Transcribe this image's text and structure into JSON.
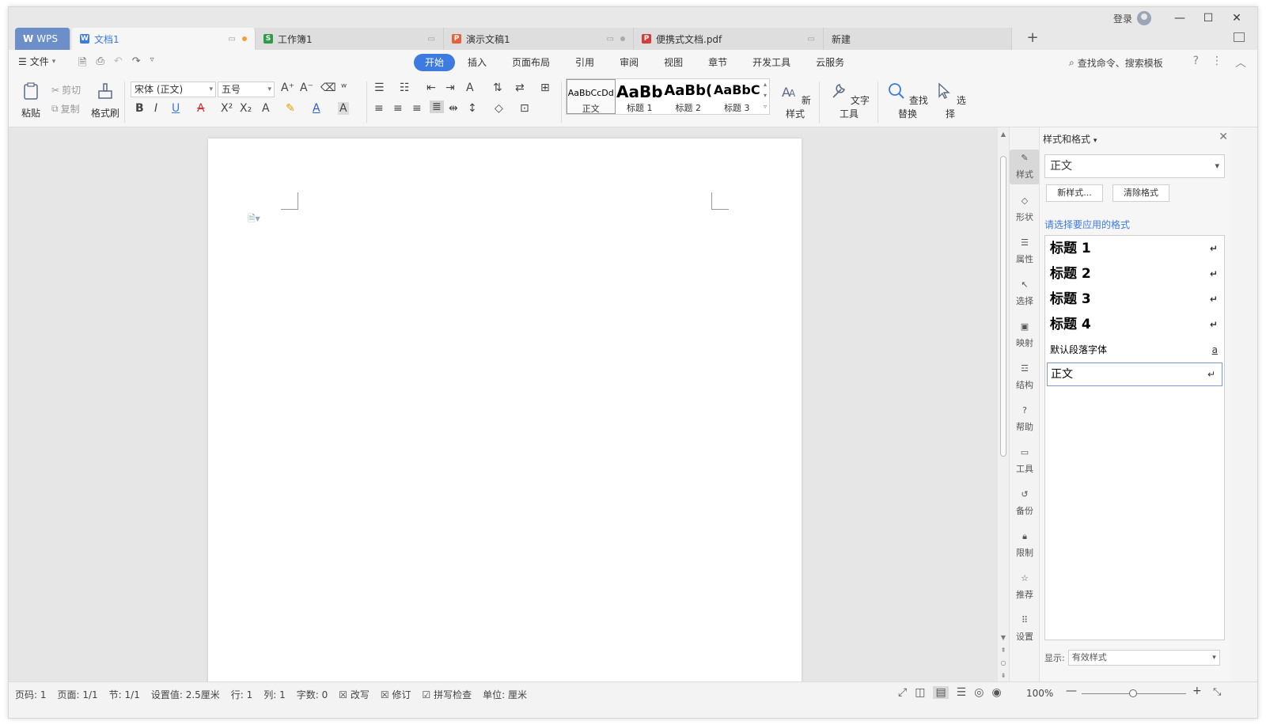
{
  "titlebar": {
    "login": "登录",
    "tabs": [
      {
        "label": "WPS",
        "icon": "wps-logo",
        "color": "#6d8fc9"
      },
      {
        "label": "文档1",
        "icon": "writer-doc-icon",
        "color": "#3d7be0"
      },
      {
        "label": "工作簿1",
        "icon": "spreadsheet-icon",
        "color": "#2e9b49"
      },
      {
        "label": "演示文稿1",
        "icon": "presentation-icon",
        "color": "#e0643c"
      },
      {
        "label": "便携式文档.pdf",
        "icon": "pdf-icon",
        "color": "#d63b3b"
      },
      {
        "label": "新建"
      }
    ],
    "window_buttons": [
      "minimize",
      "maximize",
      "close"
    ]
  },
  "menu": {
    "file_label": "文件",
    "ribbon_tabs": [
      "开始",
      "插入",
      "页面布局",
      "引用",
      "审阅",
      "视图",
      "章节",
      "开发工具",
      "云服务"
    ],
    "active_tab": "开始",
    "search_placeholder": "查找命令、搜索模板"
  },
  "ribbon": {
    "paste": "粘贴",
    "cut": "剪切",
    "copy": "复制",
    "format_painter": "格式刷",
    "font_name": "宋体 (正文)",
    "font_size": "五号",
    "styles": [
      {
        "preview": "AaBbCcDd",
        "label": "正文"
      },
      {
        "preview": "AaBb",
        "label": "标题 1"
      },
      {
        "preview": "AaBb(",
        "label": "标题 2"
      },
      {
        "preview": "AaBbC",
        "label": "标题 3"
      }
    ],
    "new_style": "新样式",
    "text_tools": "文字工具",
    "find_replace": "查找替换",
    "select": "选择"
  },
  "sidebar": {
    "items": [
      {
        "label": "样式",
        "icon": "pen-icon"
      },
      {
        "label": "形状",
        "icon": "shapes-icon"
      },
      {
        "label": "属性",
        "icon": "sliders-icon"
      },
      {
        "label": "选择",
        "icon": "cursor-icon"
      },
      {
        "label": "映射",
        "icon": "mapping-icon"
      },
      {
        "label": "结构",
        "icon": "structure-icon"
      },
      {
        "label": "帮助",
        "icon": "help-icon"
      },
      {
        "label": "工具",
        "icon": "toolbox-icon"
      },
      {
        "label": "备份",
        "icon": "history-icon"
      },
      {
        "label": "限制",
        "icon": "lock-icon"
      },
      {
        "label": "推荐",
        "icon": "star-icon"
      },
      {
        "label": "设置",
        "icon": "grid-icon"
      }
    ]
  },
  "panel": {
    "title": "样式和格式",
    "current_style": "正文",
    "new_style_btn": "新样式...",
    "clear_format_btn": "清除格式",
    "hint": "请选择要应用的格式",
    "styles": [
      {
        "label": "标题 1",
        "mark": "↵"
      },
      {
        "label": "标题 2",
        "mark": "↵"
      },
      {
        "label": "标题 3",
        "mark": "↵"
      },
      {
        "label": "标题 4",
        "mark": "↵"
      },
      {
        "label": "默认段落字体",
        "mark": "a"
      },
      {
        "label": "正文",
        "mark": "↵"
      }
    ],
    "show_label": "显示:",
    "show_value": "有效样式"
  },
  "status": {
    "items": [
      "页码: 1",
      "页面: 1/1",
      "节: 1/1",
      "设置值: 2.5厘米",
      "行: 1",
      "列: 1",
      "字数: 0",
      "改写",
      "修订",
      "拼写检查",
      "单位: 厘米"
    ],
    "zoom": "100%"
  }
}
